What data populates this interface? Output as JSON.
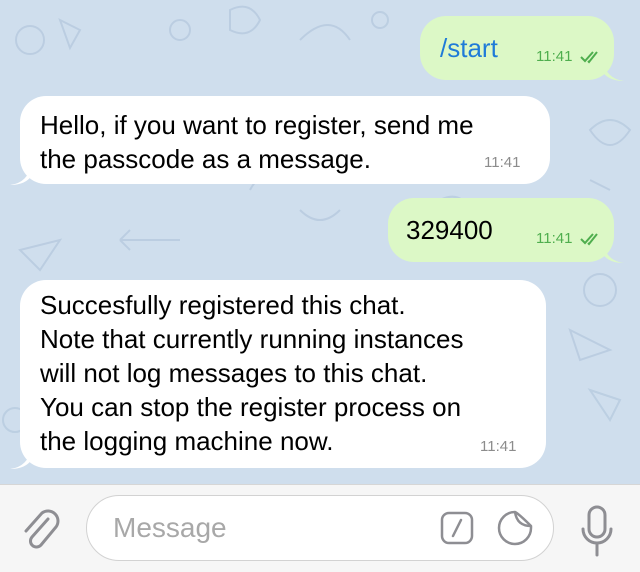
{
  "messages": [
    {
      "direction": "outgoing",
      "text": "/start",
      "time": "11:41",
      "read_icon": "double-check-icon"
    },
    {
      "direction": "incoming",
      "text": "Hello, if you want to register, send me\nthe passcode as a message.",
      "time": "11:41"
    },
    {
      "direction": "outgoing",
      "text": "329400",
      "time": "11:41",
      "read_icon": "double-check-icon"
    },
    {
      "direction": "incoming",
      "text": "Succesfully registered this chat.\nNote that currently running instances\nwill not log messages to this chat.\nYou can stop the register process on\nthe logging machine now.",
      "time": "11:41"
    }
  ],
  "composer": {
    "placeholder": "Message",
    "attach_icon": "paperclip-icon",
    "command_icon": "bot-command-icon",
    "sticker_icon": "sticker-icon",
    "mic_icon": "microphone-icon"
  },
  "colors": {
    "chat_background": "#cfdeed",
    "incoming_bubble": "#ffffff",
    "outgoing_bubble": "#dcf8c6",
    "command_link": "#1f7bd8",
    "outgoing_time": "#4fae4e",
    "incoming_time": "#8c8c8c"
  }
}
